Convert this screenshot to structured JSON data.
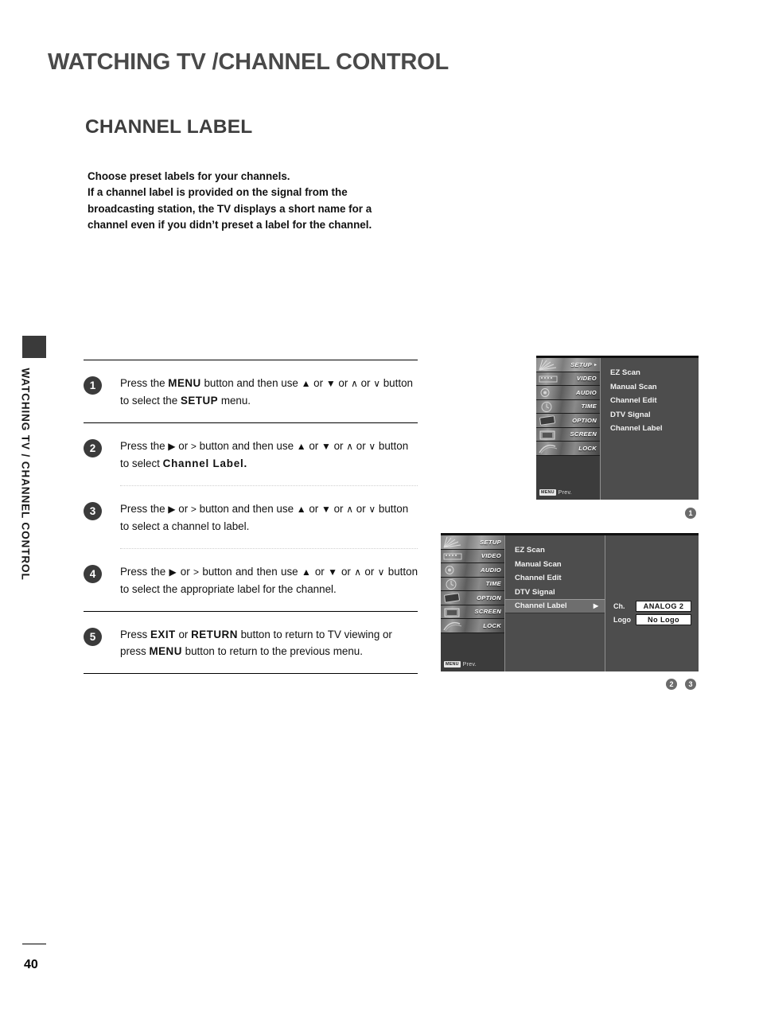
{
  "document": {
    "page_title": "WATCHING TV /CHANNEL CONTROL",
    "section_title": "CHANNEL LABEL",
    "side_tab_text": "WATCHING TV / CHANNEL CONTROL",
    "page_number": "40"
  },
  "intro": {
    "line1": "Choose preset labels for your channels.",
    "line2": "If a channel label is provided on the signal from the",
    "line3": "broadcasting station, the TV displays a short name for a",
    "line4": "channel even if you didn’t preset a label for the channel."
  },
  "steps": [
    {
      "number": "1",
      "p1": "Press the ",
      "k1": "MENU",
      "p2": " button and then use ",
      "g1": "▲",
      "p3": " or ",
      "g2": "▼",
      "p4": "  or  ",
      "g3": "∧",
      "p5": " or ",
      "g4": "∨",
      "p6": "  button to select the ",
      "k2": "SETUP",
      "p7": " menu."
    },
    {
      "number": "2",
      "p1": "Press the ",
      "g0": "▶",
      "p2": "  or  ",
      "g0b": ">",
      "p3": "  button and then use ",
      "g1": "▲",
      "p4": " or ",
      "g2": "▼",
      "p5": "  or  ",
      "g3": "∧",
      "p6": " or ",
      "g4": "∨",
      "p7": "  button to select ",
      "k1": "Channel Label.",
      "p8": ""
    },
    {
      "number": "3",
      "p1": "Press the ",
      "g0": "▶",
      "p2": "  or  ",
      "g0b": ">",
      "p3": "  button and then use ",
      "g1": "▲",
      "p4": " or ",
      "g2": "▼",
      "p5": "  or  ",
      "g3": "∧",
      "p6": " or ",
      "g4": "∨",
      "p7": "  button to select a channel to label.",
      "p8": ""
    },
    {
      "number": "4",
      "p1": "Press the ",
      "g0": "▶",
      "p2": "  or  ",
      "g0b": ">",
      "p3": "  button and then use ",
      "g1": "▲",
      "p4": " or ",
      "g2": "▼",
      "p5": "  or  ",
      "g3": "∧",
      "p6": " or ",
      "g4": "∨",
      "p7": "  button to select the appropriate label for the channel.",
      "p8": ""
    },
    {
      "number": "5",
      "p1": "Press ",
      "k1": "EXIT",
      "p2": " or ",
      "k2": "RETURN",
      "p3": " button to return to TV viewing or press ",
      "k3": "MENU",
      "p4": " button to return to the previous menu."
    }
  ],
  "osd": {
    "sidebar": [
      {
        "label": "SETUP",
        "icon": "setup-fan-icon"
      },
      {
        "label": "VIDEO",
        "icon": "video-film-icon"
      },
      {
        "label": "AUDIO",
        "icon": "audio-speaker-icon"
      },
      {
        "label": "TIME",
        "icon": "clock-icon"
      },
      {
        "label": "OPTION",
        "icon": "option-tag-icon"
      },
      {
        "label": "SCREEN",
        "icon": "screen-monitor-icon"
      },
      {
        "label": "LOCK",
        "icon": "lock-icon"
      }
    ],
    "selected_sidebar": "SETUP",
    "prev_key": "MENU",
    "prev_label": "Prev.",
    "menu_arrow": "▸",
    "items": [
      "EZ Scan",
      "Manual Scan",
      "Channel Edit",
      "DTV Signal",
      "Channel Label"
    ],
    "selected_item": "Channel Label",
    "submenu_arrow": "▶",
    "detail": {
      "ch_label": "Ch.",
      "ch_value": "ANALOG  2",
      "logo_label": "Logo",
      "logo_value": "No Logo"
    }
  },
  "figure_badges": {
    "one": "1",
    "two": "2",
    "three": "3"
  }
}
